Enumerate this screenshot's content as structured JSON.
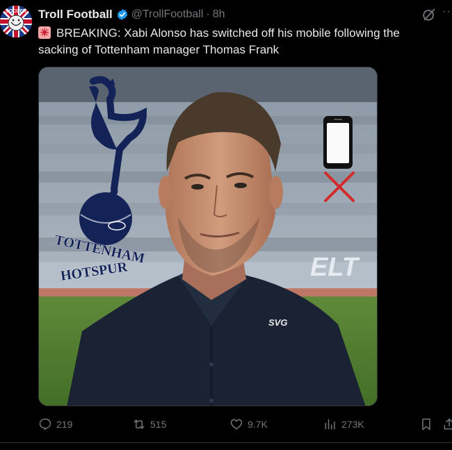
{
  "author": {
    "display_name": "Troll Football",
    "handle": "@TrollFootball",
    "separator": "·",
    "time_ago": "8h",
    "verified": true,
    "avatar_icon": "troll-football-logo",
    "avatar_text": "SOCCER"
  },
  "tweet": {
    "emoji_icon": "siren-icon",
    "body": "BREAKING: Xabi Alonso has switched off his mobile following the sacking of Tottenham manager Thomas Frank"
  },
  "media": {
    "crest_line1": "TOTTENHAM",
    "crest_line2": "HOTSPUR",
    "shirt_logo": "SVG",
    "crest_icon": "tottenham-crest",
    "phone_icon": "mobile-phone-icon",
    "cross_icon": "red-x-icon"
  },
  "actions": {
    "replies": "219",
    "reposts": "515",
    "likes": "9.7K",
    "views": "273K"
  },
  "colors": {
    "background": "#000000",
    "text": "#e7e9ea",
    "muted": "#71767b",
    "verified": "#1d9bf0",
    "spurs_navy": "#132257"
  }
}
